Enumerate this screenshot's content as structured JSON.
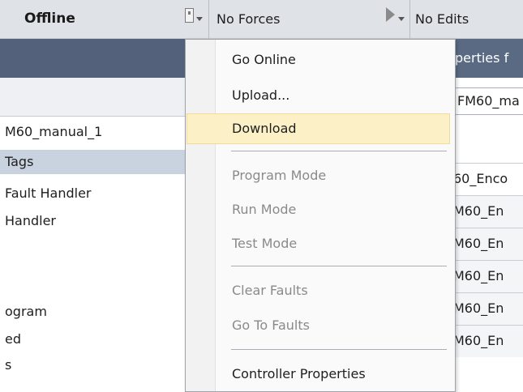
{
  "status_bar": {
    "mode": "Offline",
    "forces": "No Forces",
    "edits": "No Edits"
  },
  "tree": {
    "items": [
      {
        "label": "M60_manual_1",
        "selected": false
      },
      {
        "label": "Tags",
        "selected": true
      },
      {
        "label": "Fault Handler",
        "selected": false
      },
      {
        "label": "Handler",
        "selected": false
      },
      {
        "label": "",
        "selected": false
      },
      {
        "label": "",
        "selected": false
      },
      {
        "label": "ogram",
        "selected": false
      },
      {
        "label": "ed",
        "selected": false
      },
      {
        "label": "s",
        "selected": false
      }
    ]
  },
  "right_panel": {
    "header": "perties f",
    "field_value": "FM60_ma",
    "rows": [
      "60_Enco",
      "M60_En",
      "M60_En",
      "M60_En",
      "M60_En",
      "M60_En"
    ]
  },
  "context_menu": {
    "items": [
      {
        "label": "Go Online",
        "state": "enabled"
      },
      {
        "label": "Upload...",
        "state": "enabled"
      },
      {
        "label": "Download",
        "state": "hover"
      },
      {
        "type": "separator"
      },
      {
        "label": "Program Mode",
        "state": "disabled"
      },
      {
        "label": "Run Mode",
        "state": "disabled"
      },
      {
        "label": "Test Mode",
        "state": "disabled"
      },
      {
        "type": "separator"
      },
      {
        "label": "Clear Faults",
        "state": "disabled"
      },
      {
        "label": "Go To Faults",
        "state": "disabled"
      },
      {
        "type": "separator"
      },
      {
        "label": "Controller Properties",
        "state": "enabled"
      }
    ]
  },
  "colors": {
    "menu_highlight": "#fcf1c6",
    "header_bar": "#53627a",
    "disabled_text": "#8a8a8a"
  }
}
